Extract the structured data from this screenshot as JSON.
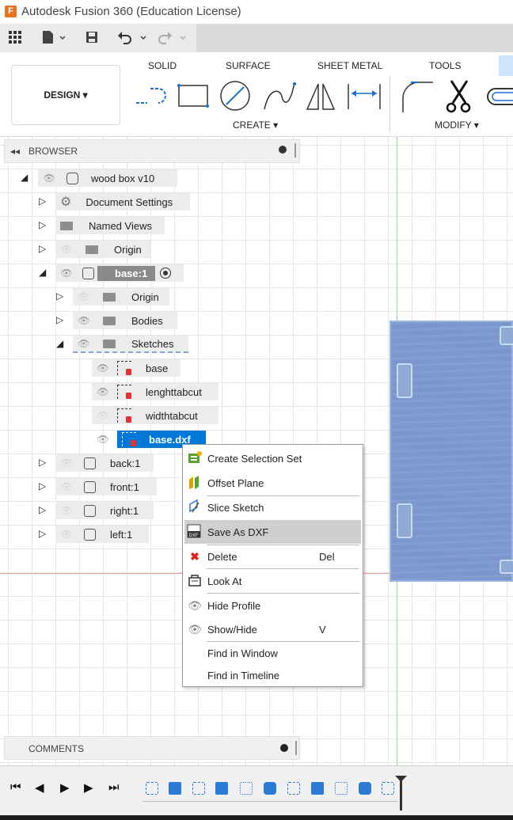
{
  "app": {
    "logo": "F",
    "title": "Autodesk Fusion 360 (Education License)"
  },
  "quick_access": {
    "icons": [
      "grid-icon",
      "file-icon",
      "save-icon",
      "undo-icon",
      "redo-icon"
    ]
  },
  "ribbon": {
    "workspace": "DESIGN ▾",
    "tabs": [
      "SOLID",
      "SURFACE",
      "SHEET METAL",
      "TOOLS"
    ],
    "groups": {
      "create": "CREATE ▾",
      "modify": "MODIFY ▾"
    }
  },
  "browser": {
    "header": "BROWSER",
    "tree": [
      {
        "label": "wood box v10"
      },
      {
        "label": "Document Settings"
      },
      {
        "label": "Named Views"
      },
      {
        "label": "Origin"
      },
      {
        "label": "base:1"
      },
      {
        "label": "Origin"
      },
      {
        "label": "Bodies"
      },
      {
        "label": "Sketches"
      },
      {
        "label": "base"
      },
      {
        "label": "lenghttabcut"
      },
      {
        "label": "widthtabcut"
      },
      {
        "label": "base.dxf"
      },
      {
        "label": "back:1"
      },
      {
        "label": "front:1"
      },
      {
        "label": "right:1"
      },
      {
        "label": "left:1"
      }
    ]
  },
  "context_menu": {
    "items": [
      {
        "label": "Create Selection Set",
        "shortcut": ""
      },
      {
        "label": "Offset Plane",
        "shortcut": ""
      },
      {
        "label": "Slice Sketch",
        "shortcut": ""
      },
      {
        "label": "Save As DXF",
        "shortcut": ""
      },
      {
        "label": "Delete",
        "shortcut": "Del"
      },
      {
        "label": "Look At",
        "shortcut": ""
      },
      {
        "label": "Hide Profile",
        "shortcut": ""
      },
      {
        "label": "Show/Hide",
        "shortcut": "V"
      },
      {
        "label": "Find in Window",
        "shortcut": ""
      },
      {
        "label": "Find in Timeline",
        "shortcut": ""
      }
    ],
    "highlighted": "Save As DXF"
  },
  "comments": {
    "header": "COMMENTS"
  },
  "timeline": {
    "controls": [
      "skip-start-icon",
      "step-back-icon",
      "play-icon",
      "step-forward-icon",
      "skip-end-icon"
    ]
  },
  "colors": {
    "selection": "#0078d7",
    "board": "#7a98cc",
    "accent": "#e8731a"
  }
}
